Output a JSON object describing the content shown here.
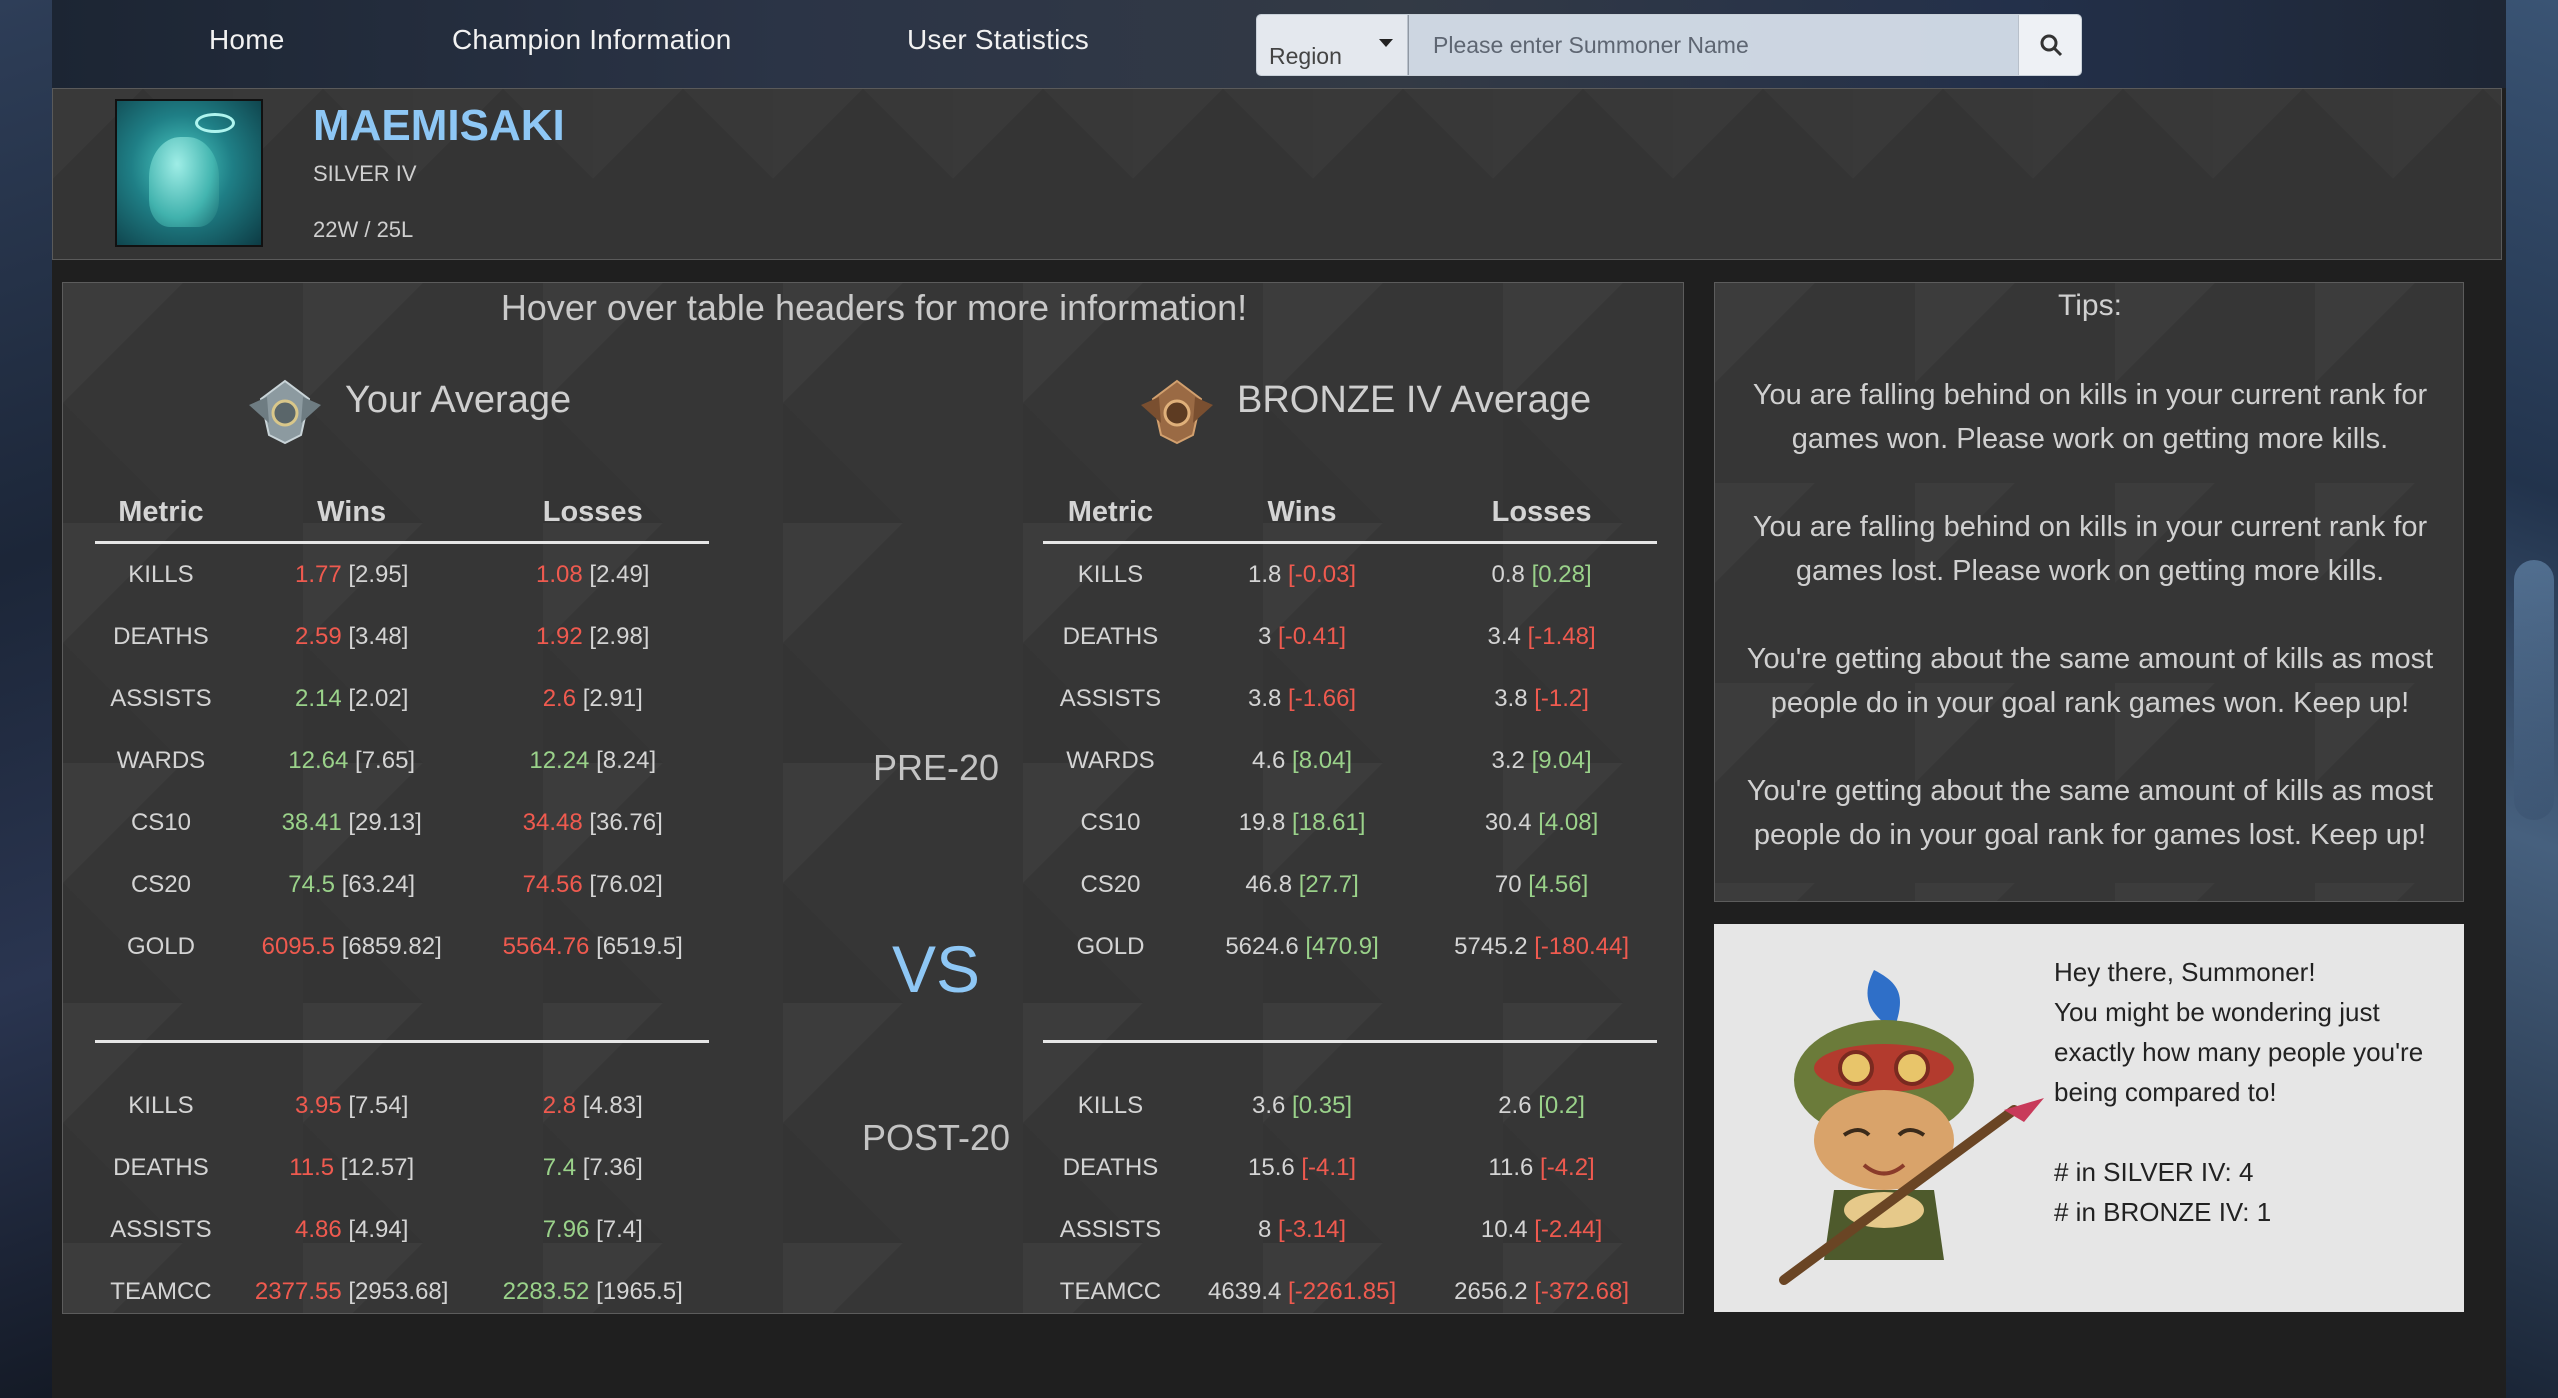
{
  "nav": {
    "home": "Home",
    "champion_info": "Champion Information",
    "user_stats": "User Statistics",
    "region_label": "Region",
    "search_placeholder": "Please enter Summoner Name"
  },
  "profile": {
    "name": "MAEMISAKI",
    "rank": "SILVER IV",
    "record": "22W / 25L"
  },
  "panel": {
    "hover_note": "Hover over table headers for more information!",
    "your_avg_title": "Your Average",
    "rank_avg_title": "BRONZE IV Average",
    "pre_label": "PRE-20",
    "vs_label": "VS",
    "post_label": "POST-20"
  },
  "headers": {
    "metric": "Metric",
    "wins": "Wins",
    "losses": "Losses"
  },
  "your_pre": [
    {
      "metric": "KILLS",
      "w": "1.77",
      "wc": "r",
      "wb": "[2.95]",
      "l": "1.08",
      "lc": "r",
      "lb": "[2.49]"
    },
    {
      "metric": "DEATHS",
      "w": "2.59",
      "wc": "r",
      "wb": "[3.48]",
      "l": "1.92",
      "lc": "r",
      "lb": "[2.98]"
    },
    {
      "metric": "ASSISTS",
      "w": "2.14",
      "wc": "g",
      "wb": "[2.02]",
      "l": "2.6",
      "lc": "r",
      "lb": "[2.91]"
    },
    {
      "metric": "WARDS",
      "w": "12.64",
      "wc": "g",
      "wb": "[7.65]",
      "l": "12.24",
      "lc": "g",
      "lb": "[8.24]"
    },
    {
      "metric": "CS10",
      "w": "38.41",
      "wc": "g",
      "wb": "[29.13]",
      "l": "34.48",
      "lc": "r",
      "lb": "[36.76]"
    },
    {
      "metric": "CS20",
      "w": "74.5",
      "wc": "g",
      "wb": "[63.24]",
      "l": "74.56",
      "lc": "r",
      "lb": "[76.02]"
    },
    {
      "metric": "GOLD",
      "w": "6095.5",
      "wc": "r",
      "wb": "[6859.82]",
      "l": "5564.76",
      "lc": "r",
      "lb": "[6519.5]"
    }
  ],
  "your_post": [
    {
      "metric": "KILLS",
      "w": "3.95",
      "wc": "r",
      "wb": "[7.54]",
      "l": "2.8",
      "lc": "r",
      "lb": "[4.83]"
    },
    {
      "metric": "DEATHS",
      "w": "11.5",
      "wc": "r",
      "wb": "[12.57]",
      "l": "7.4",
      "lc": "g",
      "lb": "[7.36]"
    },
    {
      "metric": "ASSISTS",
      "w": "4.86",
      "wc": "r",
      "wb": "[4.94]",
      "l": "7.96",
      "lc": "g",
      "lb": "[7.4]"
    },
    {
      "metric": "TEAMCC",
      "w": "2377.55",
      "wc": "r",
      "wb": "[2953.68]",
      "l": "2283.52",
      "lc": "g",
      "lb": "[1965.5]"
    }
  ],
  "rank_pre": [
    {
      "metric": "KILLS",
      "w": "1.8",
      "wb": "[-0.03]",
      "wbc": "r",
      "l": "0.8",
      "lb": "[0.28]",
      "lbc": "g"
    },
    {
      "metric": "DEATHS",
      "w": "3",
      "wb": "[-0.41]",
      "wbc": "r",
      "l": "3.4",
      "lb": "[-1.48]",
      "lbc": "r"
    },
    {
      "metric": "ASSISTS",
      "w": "3.8",
      "wb": "[-1.66]",
      "wbc": "r",
      "l": "3.8",
      "lb": "[-1.2]",
      "lbc": "r"
    },
    {
      "metric": "WARDS",
      "w": "4.6",
      "wb": "[8.04]",
      "wbc": "g",
      "l": "3.2",
      "lb": "[9.04]",
      "lbc": "g"
    },
    {
      "metric": "CS10",
      "w": "19.8",
      "wb": "[18.61]",
      "wbc": "g",
      "l": "30.4",
      "lb": "[4.08]",
      "lbc": "g"
    },
    {
      "metric": "CS20",
      "w": "46.8",
      "wb": "[27.7]",
      "wbc": "g",
      "l": "70",
      "lb": "[4.56]",
      "lbc": "g"
    },
    {
      "metric": "GOLD",
      "w": "5624.6",
      "wb": "[470.9]",
      "wbc": "g",
      "l": "5745.2",
      "lb": "[-180.44]",
      "lbc": "r"
    }
  ],
  "rank_post": [
    {
      "metric": "KILLS",
      "w": "3.6",
      "wb": "[0.35]",
      "wbc": "g",
      "l": "2.6",
      "lb": "[0.2]",
      "lbc": "g"
    },
    {
      "metric": "DEATHS",
      "w": "15.6",
      "wb": "[-4.1]",
      "wbc": "r",
      "l": "11.6",
      "lb": "[-4.2]",
      "lbc": "r"
    },
    {
      "metric": "ASSISTS",
      "w": "8",
      "wb": "[-3.14]",
      "wbc": "r",
      "l": "10.4",
      "lb": "[-2.44]",
      "lbc": "r"
    },
    {
      "metric": "TEAMCC",
      "w": "4639.4",
      "wb": "[-2261.85]",
      "wbc": "r",
      "l": "2656.2",
      "lb": "[-372.68]",
      "lbc": "r"
    }
  ],
  "tips": {
    "title": "Tips:",
    "items": [
      "You are falling behind on kills in your current rank for games won. Please work on getting more kills.",
      "You are falling behind on kills in your current rank for games lost. Please work on getting more kills.",
      "You're getting about the same amount of kills as most people do in your goal rank games won. Keep up!",
      "You're getting about the same amount of kills as most people do in your goal rank for games lost. Keep up!"
    ]
  },
  "teemo": {
    "text": "Hey there, Summoner!\nYou might be wondering just exactly how many people you're being compared to!\n\n# in SILVER IV: 4\n# in BRONZE IV: 1"
  },
  "colors": {
    "good": "#9ad28a",
    "bad": "#ef5a4f",
    "accent": "#8ec7f5"
  }
}
